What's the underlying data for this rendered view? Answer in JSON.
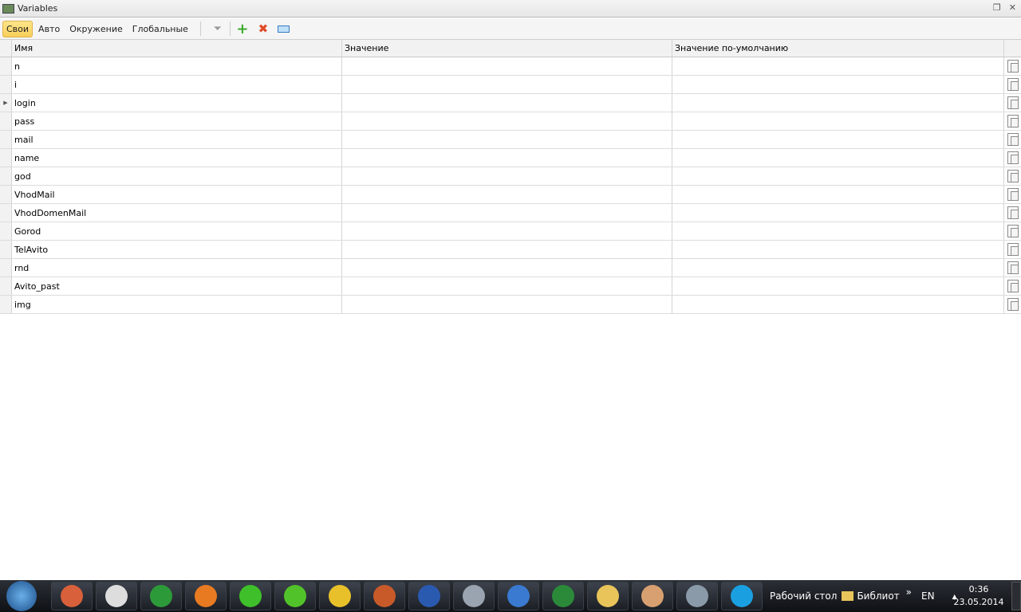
{
  "window": {
    "title": "Variables"
  },
  "toolbar": {
    "tabs": [
      "Свои",
      "Авто",
      "Окружение",
      "Глобальные"
    ],
    "active": "Свои"
  },
  "grid": {
    "columns": [
      "Имя",
      "Значение",
      "Значение по-умолчанию"
    ],
    "rows": [
      "n",
      "i",
      "login",
      "pass",
      "mail",
      "name",
      "god",
      "VhodMail",
      "VhodDomenMail",
      "Gorod",
      "TelAvito",
      "rnd",
      "Avito_past",
      "img"
    ],
    "current_row": "login"
  },
  "taskbar": {
    "desktop": "Рабочий стол",
    "library": "Библиот",
    "more": "»",
    "lang": "EN",
    "tray_arrow": "▲",
    "time": "0:36",
    "date": "23.05.2014",
    "apps": [
      {
        "name": "firefox-beta",
        "color": "#d8603a"
      },
      {
        "name": "virtualbox",
        "color": "#dddddd"
      },
      {
        "name": "utorrent",
        "color": "#2d9a3a"
      },
      {
        "name": "firefox",
        "color": "#e87a22"
      },
      {
        "name": "mail-agent",
        "color": "#3fbf2a"
      },
      {
        "name": "icq",
        "color": "#52c22a"
      },
      {
        "name": "chrome",
        "color": "#e8c02a"
      },
      {
        "name": "firefox-2",
        "color": "#c85a2a"
      },
      {
        "name": "word",
        "color": "#2a5ab0"
      },
      {
        "name": "zennoposter",
        "color": "#9aa4b0"
      },
      {
        "name": "zennoposter-2",
        "color": "#3a7ad0"
      },
      {
        "name": "excel",
        "color": "#2a8a3a"
      },
      {
        "name": "explorer",
        "color": "#e8c45a"
      },
      {
        "name": "downloader",
        "color": "#d8a070"
      },
      {
        "name": "proxy-checker",
        "color": "#8a9aa8"
      },
      {
        "name": "skype",
        "color": "#1aa0e0"
      }
    ]
  }
}
